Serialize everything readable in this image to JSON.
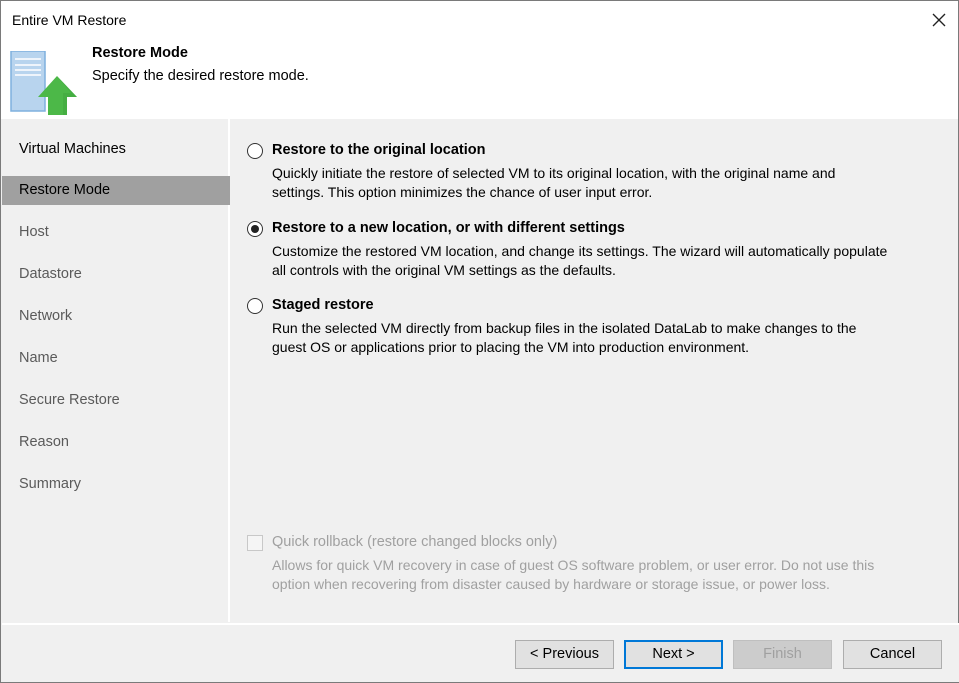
{
  "window": {
    "title": "Entire VM Restore",
    "close_icon": "close-icon"
  },
  "header": {
    "icon": "vm-restore-upload-icon",
    "title": "Restore Mode",
    "subtitle": "Specify the desired restore mode."
  },
  "sidebar": {
    "items": [
      {
        "label": "Virtual Machines",
        "state": "done"
      },
      {
        "label": "Restore Mode",
        "state": "active"
      },
      {
        "label": "Host",
        "state": "pending"
      },
      {
        "label": "Datastore",
        "state": "pending"
      },
      {
        "label": "Network",
        "state": "pending"
      },
      {
        "label": "Name",
        "state": "pending"
      },
      {
        "label": "Secure Restore",
        "state": "pending"
      },
      {
        "label": "Reason",
        "state": "pending"
      },
      {
        "label": "Summary",
        "state": "pending"
      }
    ]
  },
  "options": [
    {
      "label": "Restore to the original location",
      "checked": false,
      "desc_lines": [
        "Quickly initiate the restore of selected VM to its original location, with the original name and",
        "settings. This option minimizes the chance of user input error."
      ]
    },
    {
      "label": "Restore to a new location, or with different settings",
      "checked": true,
      "desc_lines": [
        "Customize the restored VM location, and change its settings. The wizard will automatically populate",
        "all controls with the original VM settings as the defaults."
      ]
    },
    {
      "label": "Staged restore",
      "checked": false,
      "desc_lines": [
        "Run the selected VM directly from backup files in the isolated DataLab to make changes to the",
        "guest OS or applications prior to placing the VM into production environment."
      ]
    }
  ],
  "quick_rollback": {
    "label": "Quick rollback (restore changed blocks only)",
    "checked": false,
    "enabled": false,
    "desc_lines": [
      "Allows for quick VM recovery in case of guest OS software problem, or user error. Do not use this",
      "option when recovering from disaster caused by hardware or storage issue, or power loss."
    ]
  },
  "buttons": {
    "previous": "< Previous",
    "next": "Next >",
    "finish": "Finish",
    "cancel": "Cancel"
  },
  "colors": {
    "accent": "#0078d7",
    "active_nav": "#a0a0a0",
    "icon_green": "#4cb848",
    "icon_blue": "#b8d4ee"
  }
}
